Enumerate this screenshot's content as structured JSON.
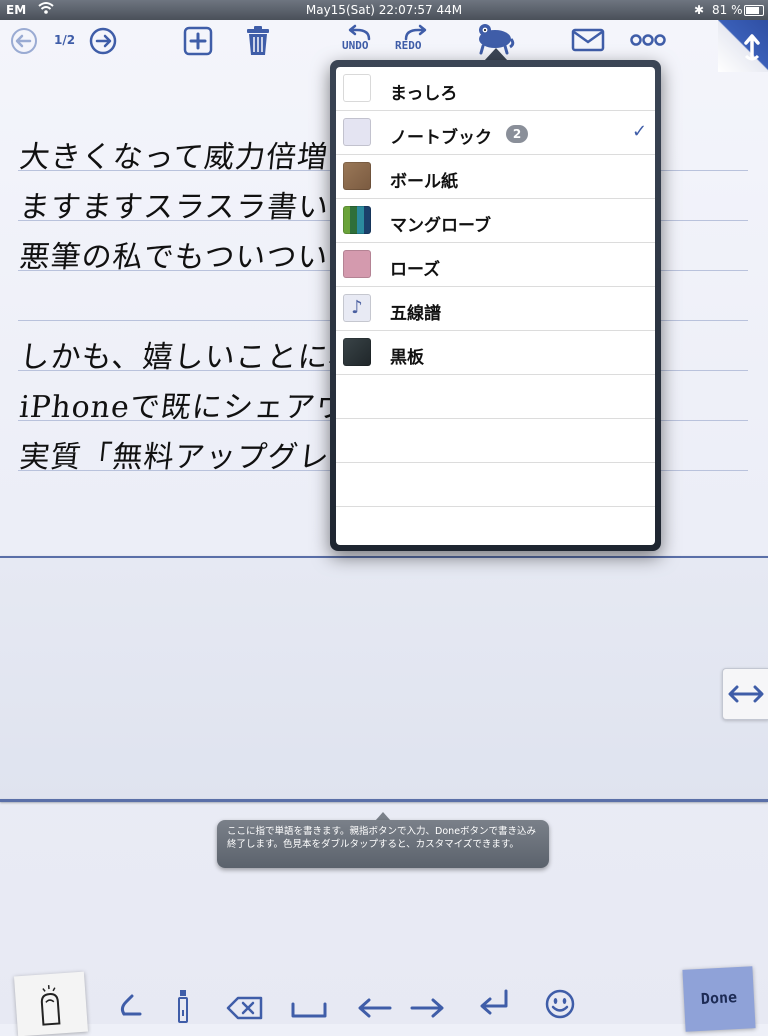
{
  "status_bar": {
    "carrier": "EM",
    "time": "May15(Sat) 22:07:57 44M",
    "battery_percent": "81 %"
  },
  "toolbar": {
    "page_indicator": "1/2",
    "undo_label": "UNDO",
    "redo_label": "REDO"
  },
  "note": {
    "lines": [
      "大きくなって威力倍増!!",
      "ますますスラスラ書いて",
      "悪筆の私でもついつい",
      "",
      "しかも、嬉しいことに、",
      "iPhoneで既にシェアウ",
      "実質「無料アップグレー"
    ]
  },
  "paper_menu": {
    "items": [
      {
        "label": "まっしろ",
        "swatch": "#ffffff",
        "badge": "",
        "checked": false
      },
      {
        "label": "ノートブック",
        "swatch": "#e4e4f2",
        "badge": "2",
        "checked": true
      },
      {
        "label": "ボール紙",
        "swatch": "#8a6a4e",
        "badge": "",
        "checked": false
      },
      {
        "label": "マングローブ",
        "swatch": "mangrove",
        "badge": "",
        "checked": false
      },
      {
        "label": "ローズ",
        "swatch": "#d49aae",
        "badge": "",
        "checked": false
      },
      {
        "label": "五線譜",
        "swatch": "#e8eaf4",
        "badge": "",
        "checked": false
      },
      {
        "label": "黒板",
        "swatch": "#2b3438",
        "badge": "",
        "checked": false
      }
    ],
    "check_mark": "✓"
  },
  "tooltip": {
    "text": "ここに指で単語を書きます。親指ボタンで入力、Doneボタンで書き込み終了します。色見本をダブルタップすると、カスタマイズできます。"
  },
  "bottom_bar": {
    "done_label": "Done"
  },
  "colors": {
    "accent": "#3f5da8",
    "rule": "#5a6fa8"
  }
}
